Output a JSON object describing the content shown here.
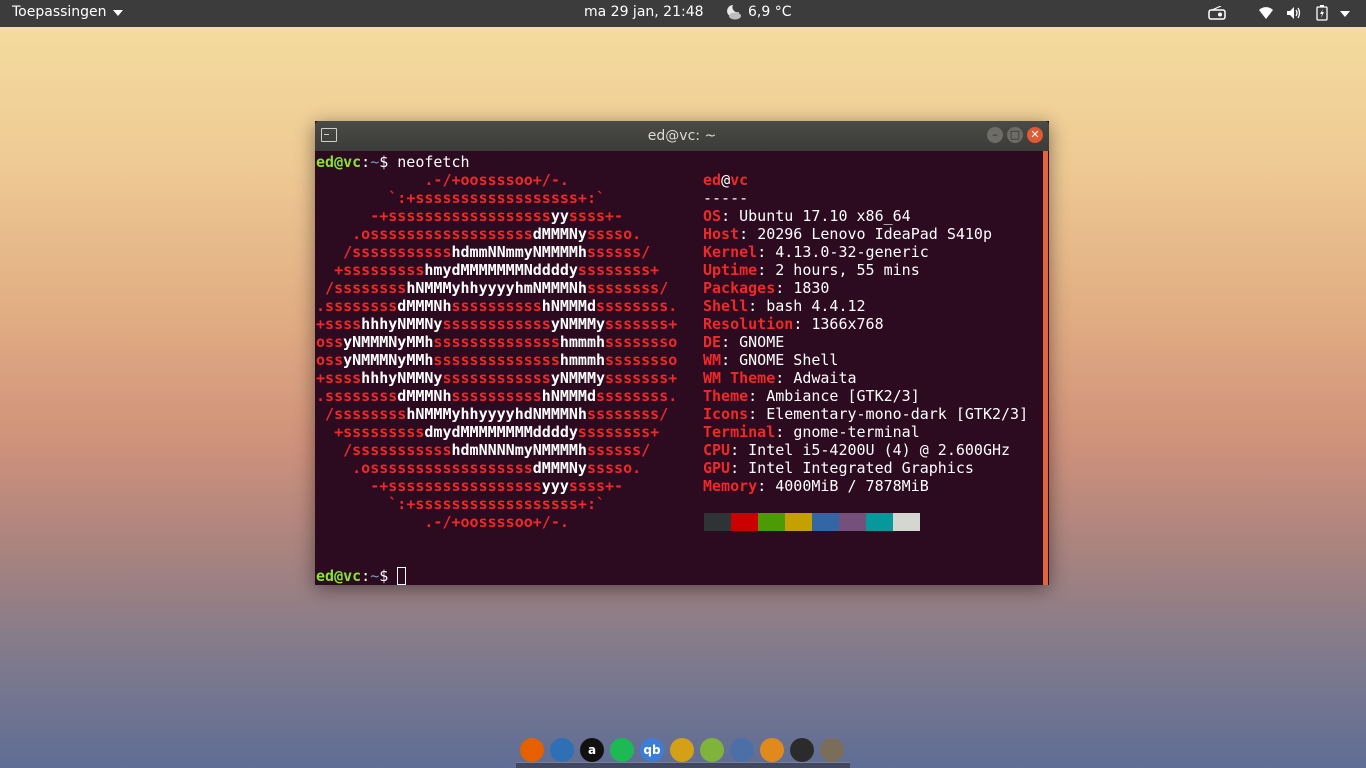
{
  "topbar": {
    "apps_label": "Toepassingen",
    "clock": "ma 29 jan, 21:48",
    "weather": "6,9 °C",
    "icons": [
      "weather-night-cloudy-icon",
      "radio-icon",
      "wifi-icon",
      "volume-icon",
      "battery-charging-icon",
      "system-menu-chevron-icon"
    ]
  },
  "window": {
    "title": "ed@vc: ~",
    "buttons": [
      "minimize",
      "maximize",
      "close"
    ]
  },
  "terminal": {
    "prompt_user": "ed",
    "prompt_at": "@",
    "prompt_host": "vc",
    "prompt_colon": ":",
    "prompt_path": "~",
    "prompt_dollar": "$ ",
    "command": "neofetch",
    "logo": [
      "            .-/+oossssoo+/-.",
      "        `:+ssssssssssssssssss+:`",
      "      -+ssssssssssssssssssyyssss+-",
      "    .ossssssssssssssssssdMMMNysssso.",
      "   /ssssssssssshdmmNNmmyNMMMMhssssss/",
      "  +ssssssssshmydMMMMMMMNddddyssssssss+",
      " /sssssssshNMMMyhhyyyyhmNMMMNhssssssss/",
      ".ssssssssdMMMNhsssssssssshNMMMdssssssss.",
      "+sssshhhyNMMNyssssssssssssyNMMMysssssss+",
      "ossyNMMMNyMMhsssssssssssssshmmmhssssssso",
      "ossyNMMMNyMMhsssssssssssssshmmmhssssssso",
      "+sssshhhyNMMNyssssssssssssyNMMMysssssss+",
      ".ssssssssdMMMNhsssssssssshNMMMdssssssss.",
      " /sssssssshNMMMyhhyyyyhdNMMMNhssssssss/",
      "  +sssssssssdmydMMMMMMMMddddyssssssss+",
      "   /ssssssssssshdmNNNNmyNMMMMhssssss/",
      "    .ossssssssssssssssssdMMMNysssso.",
      "      -+sssssssssssssssssyyyssss+-",
      "        `:+ssssssssssssssssss+:`",
      "            .-/+oossssoo+/-."
    ],
    "title_user": "ed",
    "title_at": "@",
    "title_host": "vc",
    "separator": "-----",
    "info": [
      {
        "key": "OS",
        "value": "Ubuntu 17.10 x86_64"
      },
      {
        "key": "Host",
        "value": "20296 Lenovo IdeaPad S410p"
      },
      {
        "key": "Kernel",
        "value": "4.13.0-32-generic"
      },
      {
        "key": "Uptime",
        "value": "2 hours, 55 mins"
      },
      {
        "key": "Packages",
        "value": "1830"
      },
      {
        "key": "Shell",
        "value": "bash 4.4.12"
      },
      {
        "key": "Resolution",
        "value": "1366x768"
      },
      {
        "key": "DE",
        "value": "GNOME"
      },
      {
        "key": "WM",
        "value": "GNOME Shell"
      },
      {
        "key": "WM Theme",
        "value": "Adwaita"
      },
      {
        "key": "Theme",
        "value": "Ambiance [GTK2/3]"
      },
      {
        "key": "Icons",
        "value": "Elementary-mono-dark [GTK2/3]"
      },
      {
        "key": "Terminal",
        "value": "gnome-terminal"
      },
      {
        "key": "CPU",
        "value": "Intel i5-4200U (4) @ 2.600GHz"
      },
      {
        "key": "GPU",
        "value": "Intel Integrated Graphics"
      },
      {
        "key": "Memory",
        "value": "4000MiB / 7878MiB"
      }
    ],
    "palette": [
      "#2e3436",
      "#cc0000",
      "#4e9a06",
      "#c4a000",
      "#3465a4",
      "#75507b",
      "#06989a",
      "#d3d7cf"
    ]
  },
  "dock": {
    "apps": [
      {
        "name": "firefox-icon",
        "color": "#e66000",
        "glyph": ""
      },
      {
        "name": "thunderbird-icon",
        "color": "#2f6fb5",
        "glyph": ""
      },
      {
        "name": "amazon-icon",
        "color": "#111111",
        "glyph": "a"
      },
      {
        "name": "spotify-icon",
        "color": "#1db954",
        "glyph": ""
      },
      {
        "name": "qbittorrent-icon",
        "color": "#3d7dd8",
        "glyph": "qb"
      },
      {
        "name": "puzzle-app-icon",
        "color": "#d4a017",
        "glyph": ""
      },
      {
        "name": "rss-reader-icon",
        "color": "#7fb33a",
        "glyph": ""
      },
      {
        "name": "file-manager-icon",
        "color": "#4d6fa8",
        "glyph": ""
      },
      {
        "name": "settings-gear-icon",
        "color": "#e08a1e",
        "glyph": ""
      },
      {
        "name": "terminal-icon",
        "color": "#2b2b2b",
        "glyph": ""
      },
      {
        "name": "gimp-icon",
        "color": "#7a6e5a",
        "glyph": ""
      }
    ]
  }
}
